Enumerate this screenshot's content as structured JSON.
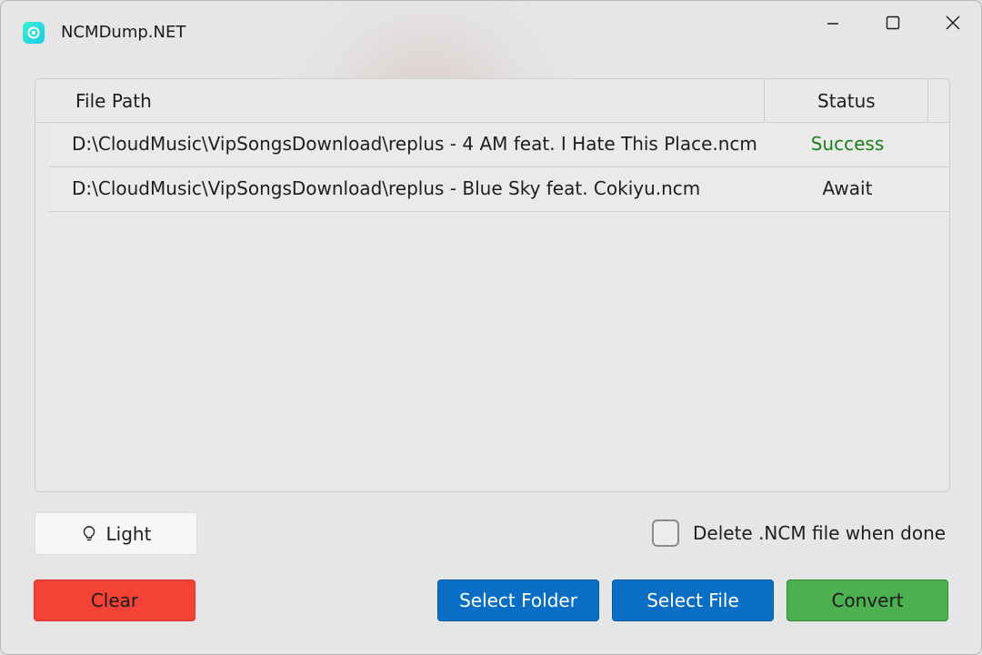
{
  "window": {
    "title": "NCMDump.NET",
    "controls": [
      "minimize-icon",
      "maximize-icon",
      "close-icon"
    ]
  },
  "table": {
    "headers": {
      "path": "File Path",
      "status": "Status"
    },
    "rows": [
      {
        "path": "D:\\CloudMusic\\VipSongsDownload\\replus - 4 AM feat. I Hate This Place.ncm",
        "status": "Success",
        "status_color": "#1a7f1a"
      },
      {
        "path": "D:\\CloudMusic\\VipSongsDownload\\replus - Blue Sky feat. Cokiyu.ncm",
        "status": "Await",
        "status_color": "#1e1e1e"
      }
    ]
  },
  "options": {
    "theme_label": "Light",
    "theme_icon": "lightbulb-icon",
    "delete_label": "Delete .NCM file when done",
    "delete_checked": false
  },
  "actions": {
    "clear": "Clear",
    "select_folder": "Select Folder",
    "select_file": "Select File",
    "convert": "Convert"
  },
  "colors": {
    "clear": "#f44336",
    "primary": "#0a6fc4",
    "convert": "#4caf50",
    "success": "#1a7f1a"
  }
}
